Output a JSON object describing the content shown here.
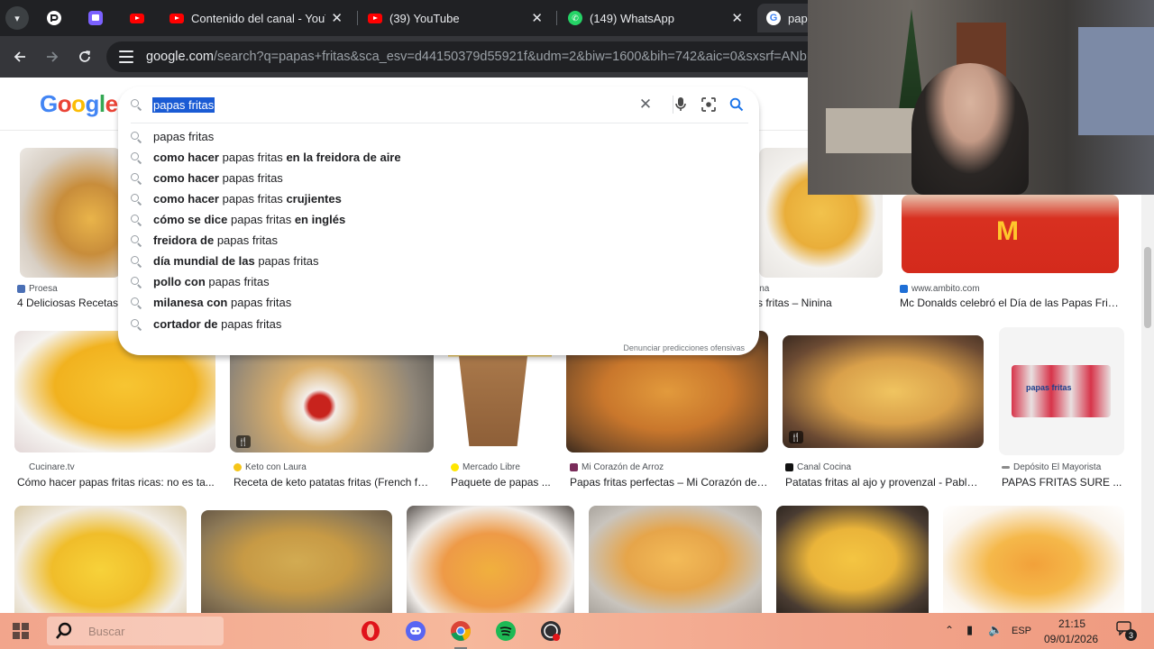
{
  "tabs": [
    {
      "title": "Contenido del canal - YouTube",
      "icon": "youtube-icon"
    },
    {
      "title": "(39) YouTube",
      "icon": "youtube-icon"
    },
    {
      "title": "(149) WhatsApp",
      "icon": "whatsapp-icon"
    },
    {
      "title": "papas fritas - Buscar con Google",
      "icon": "google-icon"
    }
  ],
  "url": {
    "host": "google.com",
    "path": "/search?q=papas+fritas&sca_esv=d44150379d55921f&udm=2&biw=1600&bih=742&aic=0&sxsrf=ANbL-n"
  },
  "google": {
    "logo": [
      "G",
      "o",
      "o",
      "g",
      "l",
      "e"
    ]
  },
  "search": {
    "query": "papas fritas",
    "report_link": "Denunciar predicciones ofensivas",
    "suggestions": [
      {
        "pre": "",
        "core": "papas fritas",
        "post": ""
      },
      {
        "pre": "como hacer",
        "core": "papas fritas",
        "post": "en la freidora de aire"
      },
      {
        "pre": "como hacer",
        "core": "papas fritas",
        "post": ""
      },
      {
        "pre": "como hacer",
        "core": "papas fritas",
        "post": "crujientes"
      },
      {
        "pre": "cómo se dice",
        "core": "papas fritas",
        "post": "en inglés"
      },
      {
        "pre": "freidora de",
        "core": "papas fritas",
        "post": ""
      },
      {
        "pre": "día mundial de las",
        "core": "papas fritas",
        "post": ""
      },
      {
        "pre": "pollo con",
        "core": "papas fritas",
        "post": ""
      },
      {
        "pre": "milanesa con",
        "core": "papas fritas",
        "post": ""
      },
      {
        "pre": "cortador de",
        "core": "papas fritas",
        "post": ""
      }
    ]
  },
  "results": {
    "row1": [
      {
        "source": "Proesa",
        "caption": "4 Deliciosas Recetas"
      },
      {
        "source": "",
        "caption": ""
      },
      {
        "source": "ina",
        "caption": "s fritas – Ninina"
      },
      {
        "source": "www.ambito.com",
        "caption": "Mc Donalds celebró el Día de las Papas Frita..."
      }
    ],
    "row2": [
      {
        "source": "Cucinare.tv",
        "caption": "Cómo hacer papas fritas ricas: no es ta..."
      },
      {
        "source": "Keto con Laura",
        "caption": "Receta de keto patatas fritas (French fri..."
      },
      {
        "source": "Mercado Libre",
        "caption": "Paquete de papas ..."
      },
      {
        "source": "Mi Corazón de Arroz",
        "caption": "Papas fritas perfectas – Mi Corazón de ..."
      },
      {
        "source": "Canal Cocina",
        "caption": "Patatas fritas al ajo y provenzal - Pablo ..."
      },
      {
        "source": "Depósito El Mayorista",
        "caption": "PAPAS FRITAS SURE ..."
      }
    ],
    "package_label": "papas fritas",
    "mcd_logo": "M"
  },
  "taskbar": {
    "search_placeholder": "Buscar",
    "lang": "ESP",
    "time": "21:15",
    "date": "09/01/2026",
    "notifications": "3"
  },
  "colors": {
    "accent": "#1a73e8",
    "tab_bg": "#202124",
    "taskbar": "#f2a58c"
  }
}
